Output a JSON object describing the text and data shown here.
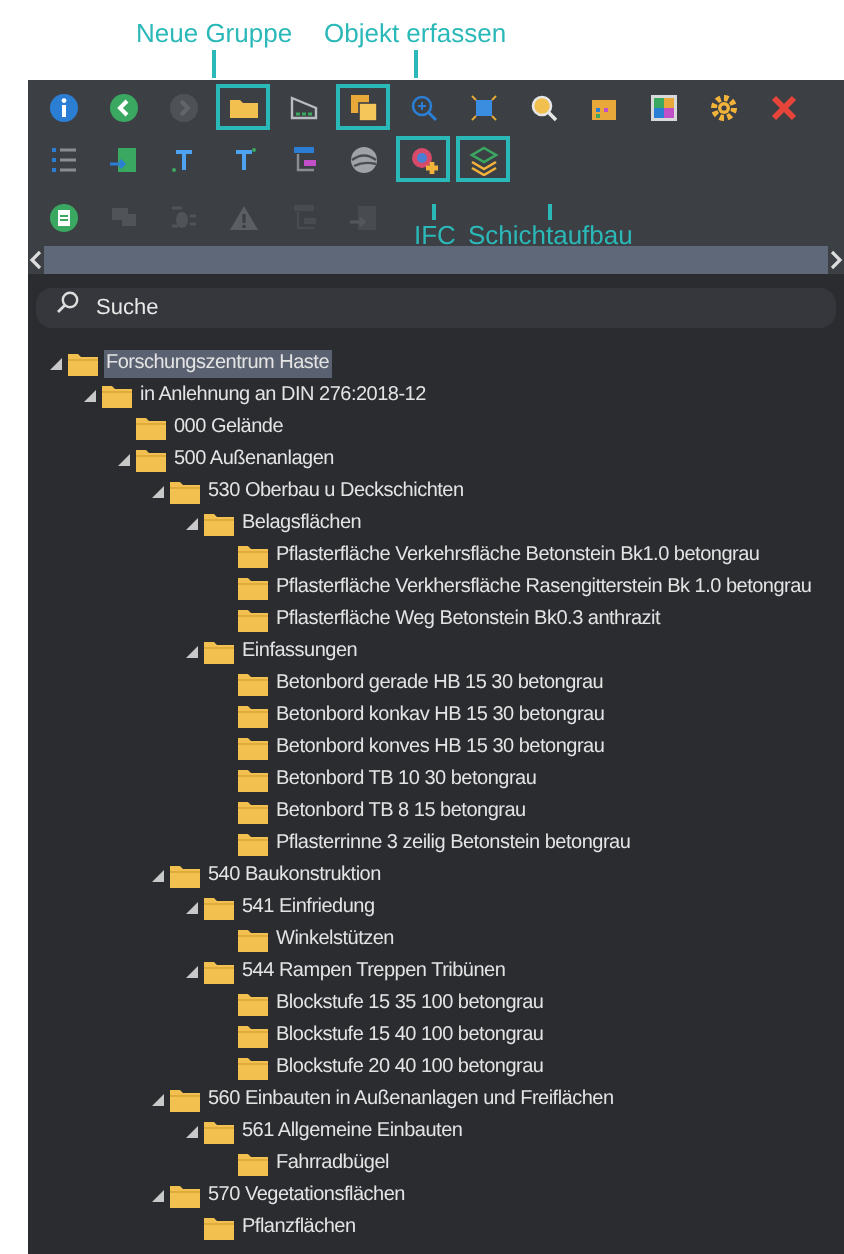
{
  "callouts_top": [
    {
      "label": "Neue Gruppe"
    },
    {
      "label": "Objekt erfassen"
    }
  ],
  "toolbar": {
    "rows": [
      [
        {
          "highlighted": false,
          "disabled": false
        },
        {
          "highlighted": false,
          "disabled": false
        },
        {
          "highlighted": false,
          "disabled": true
        },
        {
          "highlighted": true,
          "disabled": false
        },
        {
          "highlighted": false,
          "disabled": false
        },
        {
          "highlighted": true,
          "disabled": false
        },
        {
          "highlighted": false,
          "disabled": false
        },
        {
          "highlighted": false,
          "disabled": false
        },
        {
          "highlighted": false,
          "disabled": false
        },
        {
          "highlighted": false,
          "disabled": false
        },
        {
          "highlighted": false,
          "disabled": false
        },
        {
          "highlighted": false,
          "disabled": false
        },
        {
          "highlighted": false,
          "disabled": false
        }
      ],
      [
        {
          "highlighted": false,
          "disabled": false
        },
        {
          "highlighted": false,
          "disabled": false
        },
        {
          "highlighted": false,
          "disabled": false
        },
        {
          "highlighted": false,
          "disabled": false
        },
        {
          "highlighted": false,
          "disabled": false
        },
        {
          "highlighted": false,
          "disabled": false
        },
        {
          "highlighted": true,
          "disabled": false
        },
        {
          "highlighted": true,
          "disabled": false
        }
      ],
      [
        {
          "highlighted": false,
          "disabled": false
        },
        {
          "highlighted": false,
          "disabled": true
        },
        {
          "highlighted": false,
          "disabled": true
        },
        {
          "highlighted": false,
          "disabled": true
        },
        {
          "highlighted": false,
          "disabled": true
        },
        {
          "highlighted": false,
          "disabled": true
        }
      ]
    ]
  },
  "callouts_bottom": [
    {
      "label": "IFC"
    },
    {
      "label": "Schichtaufbau"
    }
  ],
  "search": {
    "placeholder": "Suche"
  },
  "tree": [
    {
      "label": "Forschungszentrum Haste",
      "selected": true,
      "expanded": true,
      "children": [
        {
          "label": "in Anlehnung an DIN 276:2018-12",
          "selected": false,
          "expanded": true,
          "children": [
            {
              "label": "000 Gelände",
              "selected": false
            },
            {
              "label": "500 Außenanlagen",
              "selected": false,
              "expanded": true,
              "children": [
                {
                  "label": "530 Oberbau u Deckschichten",
                  "selected": false,
                  "expanded": true,
                  "children": [
                    {
                      "label": "Belagsflächen",
                      "selected": false,
                      "expanded": true,
                      "children": [
                        {
                          "label": "Pflasterfläche Verkehrsfläche Betonstein Bk1.0 betongrau",
                          "selected": false
                        },
                        {
                          "label": "Pflasterfläche Verkhersfläche Rasengitterstein Bk 1.0 betongrau",
                          "selected": false
                        },
                        {
                          "label": "Pflasterfläche Weg Betonstein Bk0.3 anthrazit",
                          "selected": false
                        }
                      ]
                    },
                    {
                      "label": "Einfassungen",
                      "selected": false,
                      "expanded": true,
                      "children": [
                        {
                          "label": "Betonbord gerade HB 15 30 betongrau",
                          "selected": false
                        },
                        {
                          "label": "Betonbord konkav HB 15 30 betongrau",
                          "selected": false
                        },
                        {
                          "label": "Betonbord konves HB 15 30 betongrau",
                          "selected": false
                        },
                        {
                          "label": "Betonbord TB 10 30 betongrau",
                          "selected": false
                        },
                        {
                          "label": "Betonbord TB 8 15 betongrau",
                          "selected": false
                        },
                        {
                          "label": "Pflasterrinne 3 zeilig Betonstein betongrau",
                          "selected": false
                        }
                      ]
                    }
                  ]
                },
                {
                  "label": "540 Baukonstruktion",
                  "selected": false,
                  "expanded": true,
                  "children": [
                    {
                      "label": "541 Einfriedung",
                      "selected": false,
                      "expanded": true,
                      "children": [
                        {
                          "label": "Winkelstützen",
                          "selected": false
                        }
                      ]
                    },
                    {
                      "label": "544 Rampen Treppen Tribünen",
                      "selected": false,
                      "expanded": true,
                      "children": [
                        {
                          "label": "Blockstufe 15 35 100 betongrau",
                          "selected": false
                        },
                        {
                          "label": "Blockstufe 15 40 100 betongrau",
                          "selected": false
                        },
                        {
                          "label": "Blockstufe 20 40 100 betongrau",
                          "selected": false
                        }
                      ]
                    }
                  ]
                },
                {
                  "label": "560 Einbauten in Außenanlagen und Freiflächen",
                  "selected": false,
                  "expanded": true,
                  "children": [
                    {
                      "label": "561 Allgemeine Einbauten",
                      "selected": false,
                      "expanded": true,
                      "children": [
                        {
                          "label": "Fahrradbügel",
                          "selected": false
                        }
                      ]
                    }
                  ]
                },
                {
                  "label": "570 Vegetationsflächen",
                  "selected": false,
                  "expanded": true,
                  "children": [
                    {
                      "label": "Pflanzflächen",
                      "selected": false
                    }
                  ]
                }
              ]
            }
          ]
        }
      ]
    }
  ]
}
